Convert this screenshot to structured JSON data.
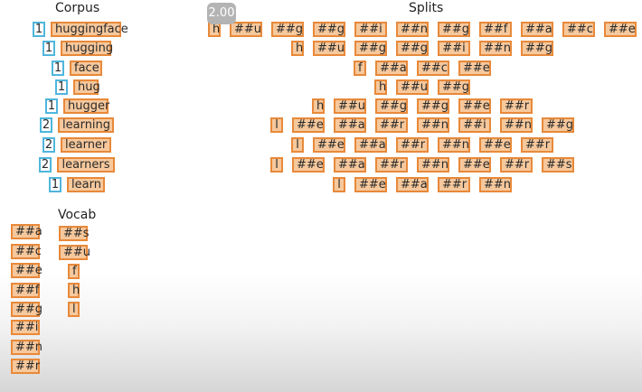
{
  "corpus": {
    "title": "Corpus",
    "rows": [
      {
        "count": "1",
        "word": "huggingface"
      },
      {
        "count": "1",
        "word": "hugging"
      },
      {
        "count": "1",
        "word": "face"
      },
      {
        "count": "1",
        "word": "hug"
      },
      {
        "count": "1",
        "word": "hugger"
      },
      {
        "count": "2",
        "word": "learning"
      },
      {
        "count": "2",
        "word": "learner"
      },
      {
        "count": "2",
        "word": "learners"
      },
      {
        "count": "1",
        "word": "learn"
      }
    ]
  },
  "splits": {
    "title": "Splits",
    "rows": [
      [
        "h",
        "##u",
        "##g",
        "##g",
        "##i",
        "##n",
        "##g",
        "##f",
        "##a",
        "##c",
        "##e"
      ],
      [
        "h",
        "##u",
        "##g",
        "##g",
        "##i",
        "##n",
        "##g"
      ],
      [
        "f",
        "##a",
        "##c",
        "##e"
      ],
      [
        "h",
        "##u",
        "##g"
      ],
      [
        "h",
        "##u",
        "##g",
        "##g",
        "##e",
        "##r"
      ],
      [
        "l",
        "##e",
        "##a",
        "##r",
        "##n",
        "##i",
        "##n",
        "##g"
      ],
      [
        "l",
        "##e",
        "##a",
        "##r",
        "##n",
        "##e",
        "##r"
      ],
      [
        "l",
        "##e",
        "##a",
        "##r",
        "##n",
        "##e",
        "##r",
        "##s"
      ],
      [
        "l",
        "##e",
        "##a",
        "##r",
        "##n"
      ]
    ]
  },
  "vocab": {
    "title": "Vocab",
    "col1": [
      "##a",
      "##c",
      "##e",
      "##f",
      "##g",
      "##i",
      "##n",
      "##r"
    ],
    "col2": [
      "##s",
      "##u",
      "f",
      "h",
      "l"
    ]
  },
  "playback_speed": "2.00"
}
